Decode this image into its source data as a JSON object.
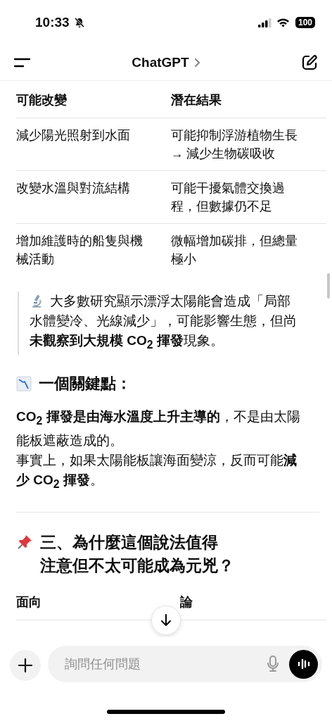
{
  "status_bar": {
    "time": "10:33",
    "battery": "100"
  },
  "header": {
    "title": "ChatGPT"
  },
  "table_1": {
    "columns": [
      "可能改變",
      "潛在結果"
    ],
    "rows": [
      [
        "減少陽光照射到水面",
        "可能抑制浮游植物生長 → 減少生物碳吸收"
      ],
      [
        "改變水溫與對流結構",
        "可能干擾氣體交換過程，但數據仍不足"
      ],
      [
        "增加維護時的船隻與機械活動",
        "微幅增加碳排，但總量極小"
      ]
    ]
  },
  "quote": "大多數研究顯示漂浮太陽能會造成「局部水體變冷、光線減少」，可能影響生態，但尚**未觀察到大規模 CO$_{2}$ 揮發**現象。",
  "section_1": {
    "heading": "一個關鍵點：",
    "paragraphs": [
      "**CO$_{2}$ 揮發是由海水溫度上升主導的**，不是由太陽能板遮蔽造成的。",
      "事實上，如果太陽能板讓海面變涼，反而可能**減少 CO$_{2}$ 揮發**。"
    ]
  },
  "section_2": {
    "heading_lines": [
      "三、為什麼這個說法值得",
      "注意但不太可能成為元兇？"
    ]
  },
  "table_2": {
    "columns": [
      "面向",
      "論"
    ]
  },
  "composer": {
    "placeholder": "詢問任何問題"
  }
}
